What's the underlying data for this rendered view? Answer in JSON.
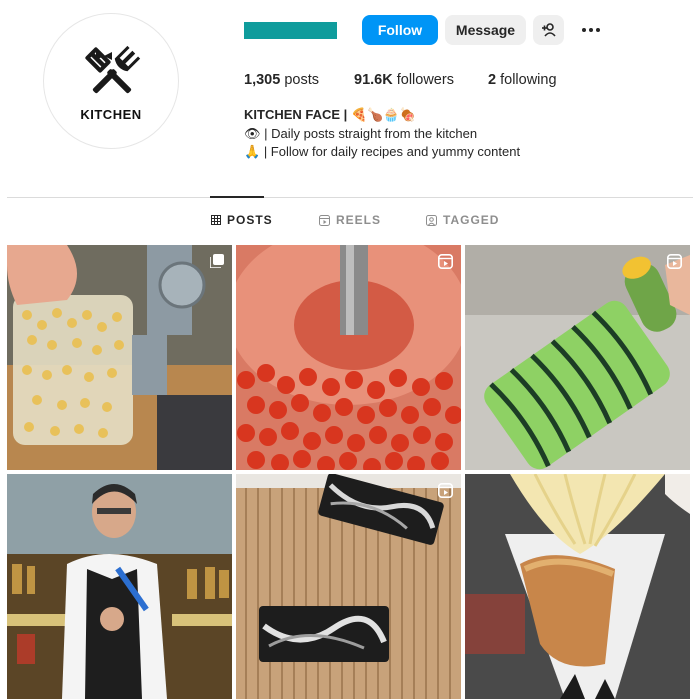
{
  "profile": {
    "avatar_text": "KITCHEN",
    "username_redacted_color": "#0f9c9c",
    "buttons": {
      "follow": "Follow",
      "message": "Message"
    },
    "stats": {
      "posts_count": "1,305",
      "posts_label": "posts",
      "followers_count": "91.6K",
      "followers_label": "followers",
      "following_count": "2",
      "following_label": "following"
    },
    "bio": {
      "name": "KITCHEN FACE |",
      "name_emojis": "🍕🍗🧁🍖",
      "line1_emoji": "👁",
      "line1_text": "| Daily posts straight from the kitchen",
      "line2_emoji": "🙏",
      "line2_text": "| Follow for daily recipes and yummy content"
    }
  },
  "tabs": [
    {
      "label": "POSTS",
      "icon": "grid-icon",
      "active": true
    },
    {
      "label": "REELS",
      "icon": "reels-icon",
      "active": false
    },
    {
      "label": "TAGGED",
      "icon": "tagged-icon",
      "active": false
    }
  ],
  "posts": [
    {
      "id": "corn",
      "badge": "carousel-icon"
    },
    {
      "id": "tomatoes",
      "badge": "reel-icon"
    },
    {
      "id": "bitter-melon",
      "badge": "reel-icon"
    },
    {
      "id": "bartender",
      "badge": "none"
    },
    {
      "id": "marble-soap",
      "badge": "reel-icon"
    },
    {
      "id": "bread-cone",
      "badge": "none"
    }
  ],
  "colors": {
    "accent": "#0095f6",
    "button_gray": "#efefef",
    "text": "#262626",
    "muted": "#8e8e8e"
  }
}
